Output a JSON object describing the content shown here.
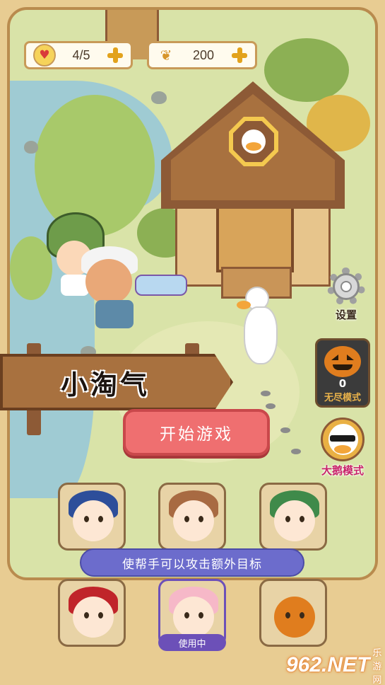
{
  "resources": {
    "lives": {
      "value": "4/5",
      "icon": "heart-icon"
    },
    "wheat": {
      "value": "200",
      "icon": "wheat-icon"
    }
  },
  "side_buttons": {
    "settings_label": "设置",
    "endless_count": "0",
    "endless_label": "无尽模式",
    "big_goose_label": "大鹅模式"
  },
  "level_sign": "小淘气",
  "start_button": "开始游戏",
  "helper_tip": "使帮手可以攻击额外目标",
  "in_use_label": "使用中",
  "characters_row1": [
    {
      "id": "blue-hair-boy"
    },
    {
      "id": "flower-girl"
    },
    {
      "id": "dino-hood-kid"
    }
  ],
  "characters_row2": [
    {
      "id": "reindeer-girl"
    },
    {
      "id": "bunny-girl"
    },
    {
      "id": "pumpkin-head"
    }
  ],
  "watermark": {
    "brand": "962.NET",
    "sub": "乐游网"
  },
  "colors": {
    "start": "#ef6f70",
    "tooltip": "#6c6ccc",
    "frame": "#b98b4e",
    "accent": "#e2a21c"
  }
}
